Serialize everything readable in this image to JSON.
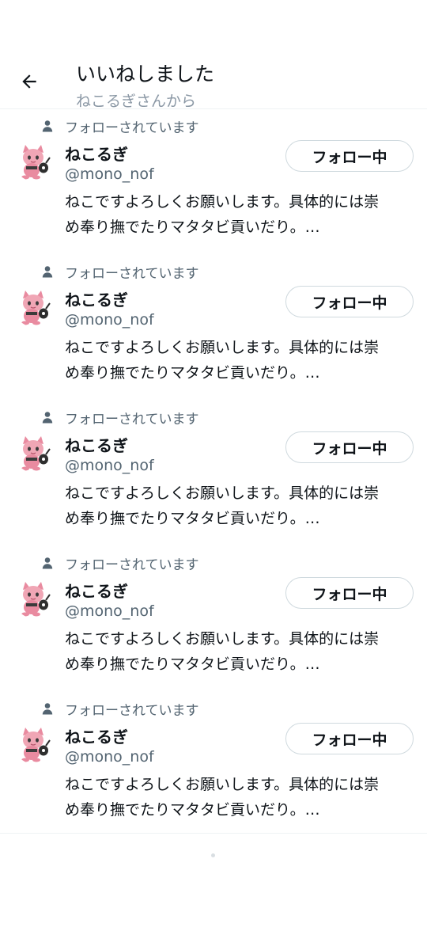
{
  "header": {
    "title": "いいねしました",
    "subtitle": "ねこるぎさんから"
  },
  "users": [
    {
      "follows_you": "フォローされています",
      "name": "ねこるぎ",
      "handle": "@mono_nof",
      "follow_label": "フォロー中",
      "bio_line1": "ねこですよろしくお願いします。具体的には崇",
      "bio_line2": "め奉り撫でたりマタタビ貢いだり。…"
    },
    {
      "follows_you": "フォローされています",
      "name": "ねこるぎ",
      "handle": "@mono_nof",
      "follow_label": "フォロー中",
      "bio_line1": "ねこですよろしくお願いします。具体的には崇",
      "bio_line2": "め奉り撫でたりマタタビ貢いだり。…"
    },
    {
      "follows_you": "フォローされています",
      "name": "ねこるぎ",
      "handle": "@mono_nof",
      "follow_label": "フォロー中",
      "bio_line1": "ねこですよろしくお願いします。具体的には崇",
      "bio_line2": "め奉り撫でたりマタタビ貢いだり。…"
    },
    {
      "follows_you": "フォローされています",
      "name": "ねこるぎ",
      "handle": "@mono_nof",
      "follow_label": "フォロー中",
      "bio_line1": "ねこですよろしくお願いします。具体的には崇",
      "bio_line2": "め奉り撫でたりマタタビ貢いだり。…"
    },
    {
      "follows_you": "フォローされています",
      "name": "ねこるぎ",
      "handle": "@mono_nof",
      "follow_label": "フォロー中",
      "bio_line1": "ねこですよろしくお願いします。具体的には崇",
      "bio_line2": "め奉り撫でたりマタタビ貢いだり。…"
    }
  ],
  "icons": {
    "back": "arrow-left-icon",
    "follows_you": "person-icon",
    "avatar": "pink-cat-character-avatar"
  },
  "colors": {
    "primary_text": "#0f1419",
    "secondary_text": "#536471",
    "subtitle_text": "#8b98a5",
    "border": "#cfd9de",
    "divider": "#eff3f4",
    "avatar_pink": "#e98ba0"
  }
}
